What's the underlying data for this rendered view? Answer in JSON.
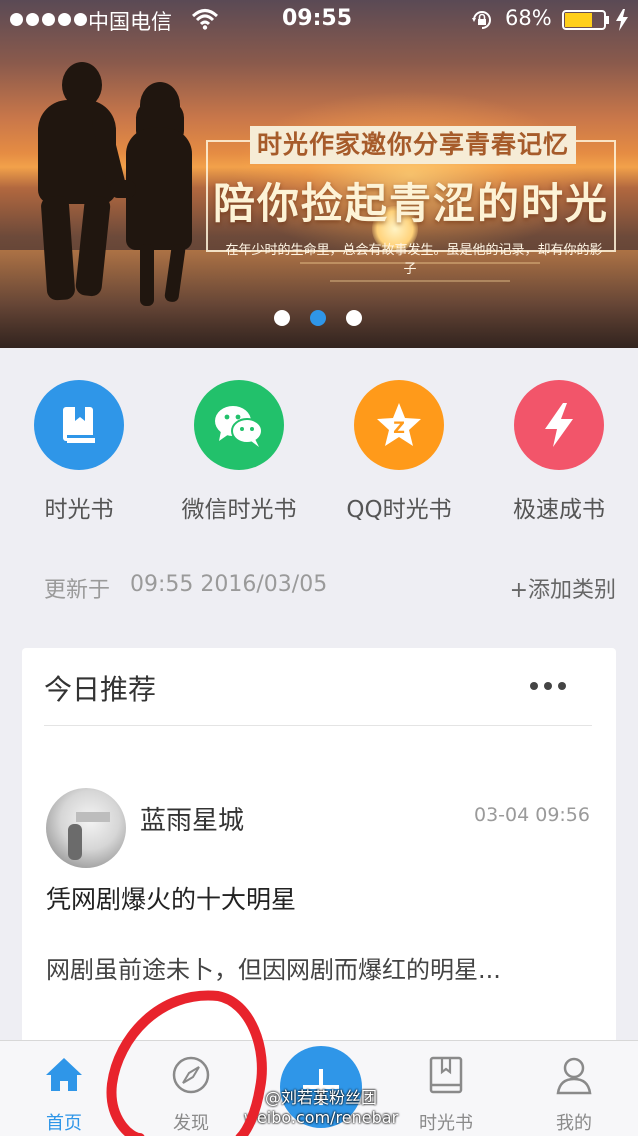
{
  "status_bar": {
    "carrier": "中国电信",
    "time": "09:55",
    "battery": "68%"
  },
  "banner": {
    "tag": "时光作家邀你分享青春记忆",
    "headline": "陪你捡起青涩的时光",
    "subtitle": "在年少时的生命里，总会有故事发生。虽是他的记录，却有你的影子",
    "page_count": 3,
    "active_page": 2
  },
  "shortcuts": [
    {
      "label": "时光书",
      "icon": "book-icon",
      "color": "#2f96e8"
    },
    {
      "label": "微信时光书",
      "icon": "wechat-icon",
      "color": "#22c16b"
    },
    {
      "label": "QQ时光书",
      "icon": "qq-star-icon",
      "color": "#ff9a1a"
    },
    {
      "label": "极速成书",
      "icon": "lightning-icon",
      "color": "#f2556a"
    }
  ],
  "update": {
    "label": "更新于",
    "time": "09:55 2016/03/05",
    "add_category": "+添加类别"
  },
  "card": {
    "title": "今日推荐",
    "author": "蓝雨星城",
    "time": "03-04 09:56",
    "post_title": "凭网剧爆火的十大明星",
    "excerpt": "网剧虽前途未卜，但因网剧而爆红的明星..."
  },
  "tabbar": {
    "items": [
      {
        "label": "首页",
        "icon": "home-icon",
        "active": true
      },
      {
        "label": "发现",
        "icon": "compass-icon",
        "active": false
      },
      {
        "label": "",
        "icon": "plus-icon",
        "active": false
      },
      {
        "label": "时光书",
        "icon": "book-outline-icon",
        "active": false
      },
      {
        "label": "我的",
        "icon": "user-icon",
        "active": false
      }
    ]
  },
  "watermark": {
    "line1": "@刘若英粉丝团",
    "line2": "weibo.com/renebar"
  },
  "colors": {
    "accent": "#2f96e8",
    "annotation": "#e8232c"
  }
}
